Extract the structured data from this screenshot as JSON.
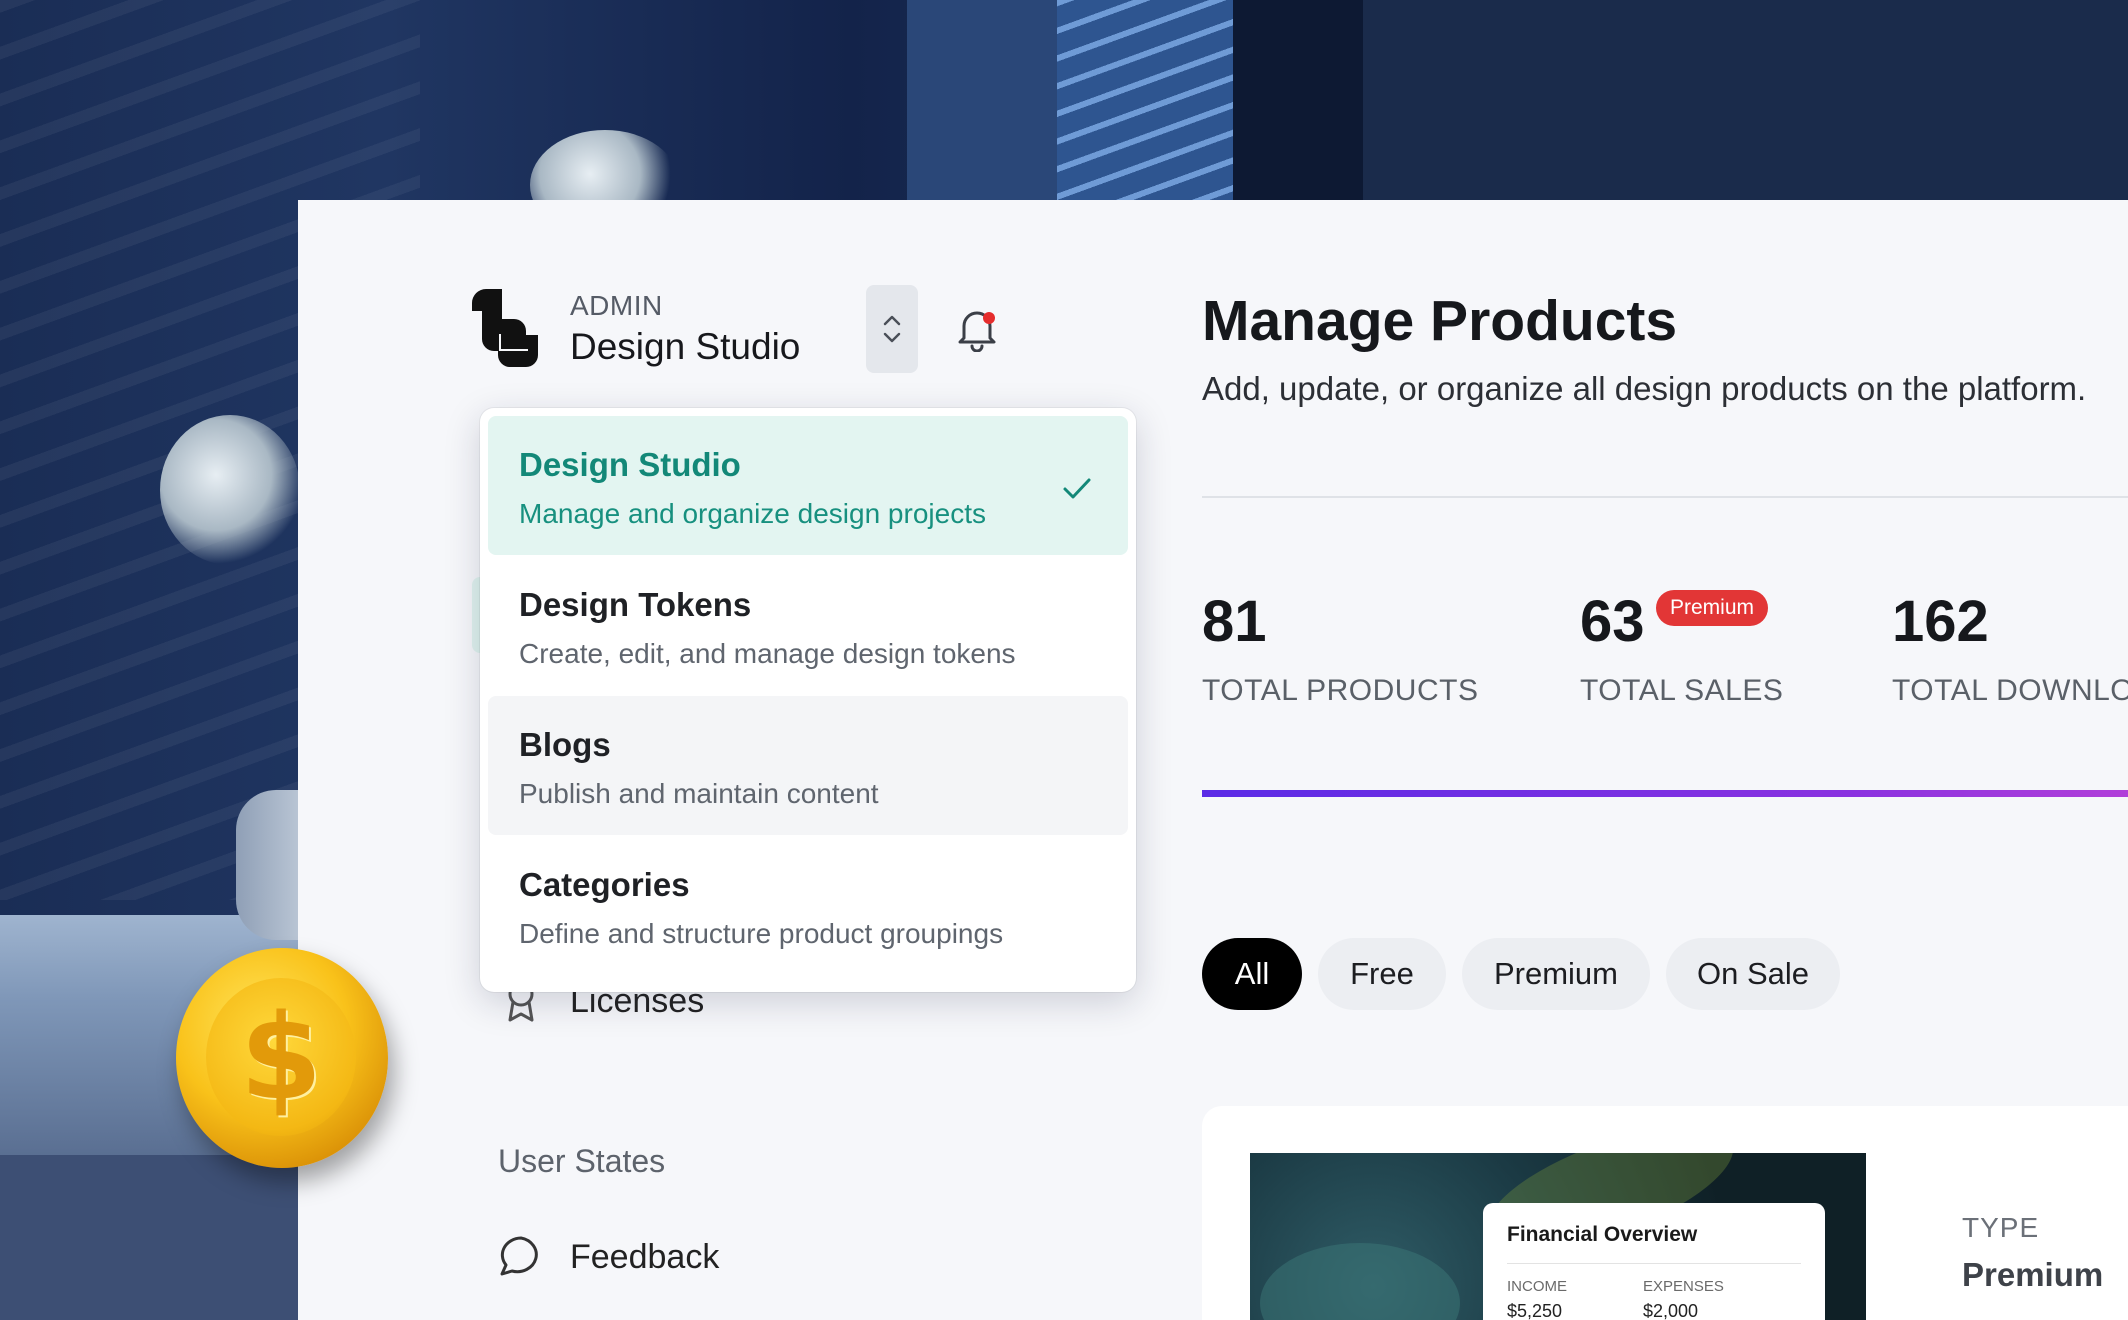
{
  "workspace": {
    "role_label": "ADMIN",
    "name": "Design Studio"
  },
  "dropdown": {
    "items": [
      {
        "title": "Design Studio",
        "subtitle": "Manage and organize design projects",
        "selected": true
      },
      {
        "title": "Design Tokens",
        "subtitle": "Create, edit, and manage design tokens",
        "selected": false
      },
      {
        "title": "Blogs",
        "subtitle": "Publish and maintain content",
        "selected": false
      },
      {
        "title": "Categories",
        "subtitle": "Define and structure product groupings",
        "selected": false
      }
    ]
  },
  "sidebar": {
    "licenses_label": "Licenses",
    "section_title": "User States",
    "feedback_label": "Feedback"
  },
  "main": {
    "title": "Manage Products",
    "subtitle": "Add, update, or organize all design products on the platform.",
    "stats": [
      {
        "value": "81",
        "label": "TOTAL PRODUCTS"
      },
      {
        "value": "63",
        "label": "TOTAL SALES",
        "badge": "Premium"
      },
      {
        "value": "162",
        "label": "TOTAL DOWNLOA"
      }
    ],
    "progress_fraction": 1.0,
    "filters": [
      {
        "label": "All",
        "active": true
      },
      {
        "label": "Free",
        "active": false
      },
      {
        "label": "Premium",
        "active": false
      },
      {
        "label": "On Sale",
        "active": false
      }
    ]
  },
  "product_card": {
    "preview": {
      "title": "Financial Overview",
      "col1_label": "INCOME",
      "col1_value": "$5,250",
      "col2_label": "EXPENSES",
      "col2_value": "$2,000"
    },
    "type_label": "TYPE",
    "type_value": "Premium"
  },
  "colors": {
    "accent_teal": "#138878",
    "selected_bg": "#e3f5f1",
    "badge_red": "#e23636",
    "progress_start": "#5b2be6",
    "progress_end": "#b13fd9",
    "notification_dot": "#e52d2d"
  },
  "icons": {
    "logo": "brand-logo",
    "switcher": "chevron-up-down-icon",
    "bell": "bell-icon",
    "check": "check-icon",
    "licenses": "award-icon",
    "feedback": "chat-bubble-icon"
  }
}
